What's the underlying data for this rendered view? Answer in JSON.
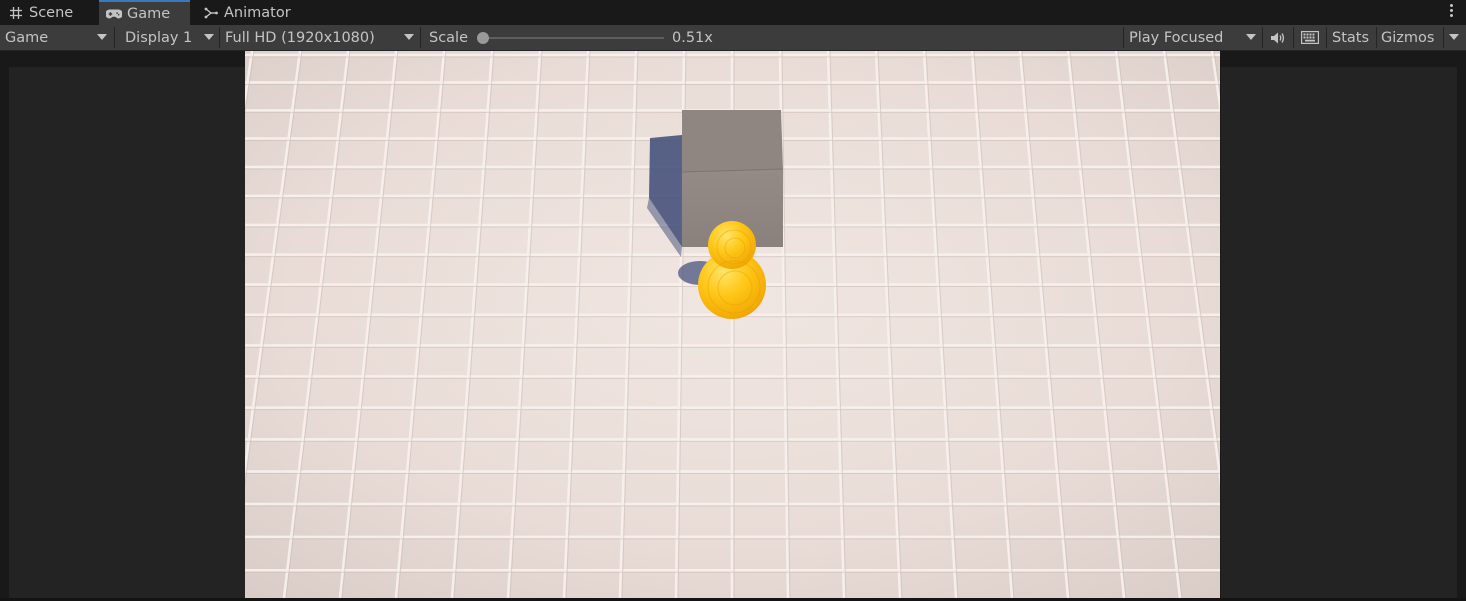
{
  "tabs": [
    {
      "label": "Scene",
      "icon": "grid-icon",
      "active": false
    },
    {
      "label": "Game",
      "icon": "gamepad-icon",
      "active": true
    },
    {
      "label": "Animator",
      "icon": "animator-icon",
      "active": false
    }
  ],
  "toolbar": {
    "view_mode": "Game",
    "display": "Display 1",
    "resolution": "Full HD (1920x1080)",
    "scale_label": "Scale",
    "scale_value": "0.51x",
    "scale_fraction": 0.0,
    "play_mode": "Play Focused",
    "stats_label": "Stats",
    "gizmos_label": "Gizmos",
    "mute_icon": "speaker-icon",
    "keyboard_icon": "keyboard-icon"
  },
  "colors": {
    "accent": "#3a79bb",
    "panel": "#3c3c3c",
    "background": "#191919",
    "floor": "#e8dcd6",
    "cube": "#8e8580",
    "character": "#f5b400"
  }
}
